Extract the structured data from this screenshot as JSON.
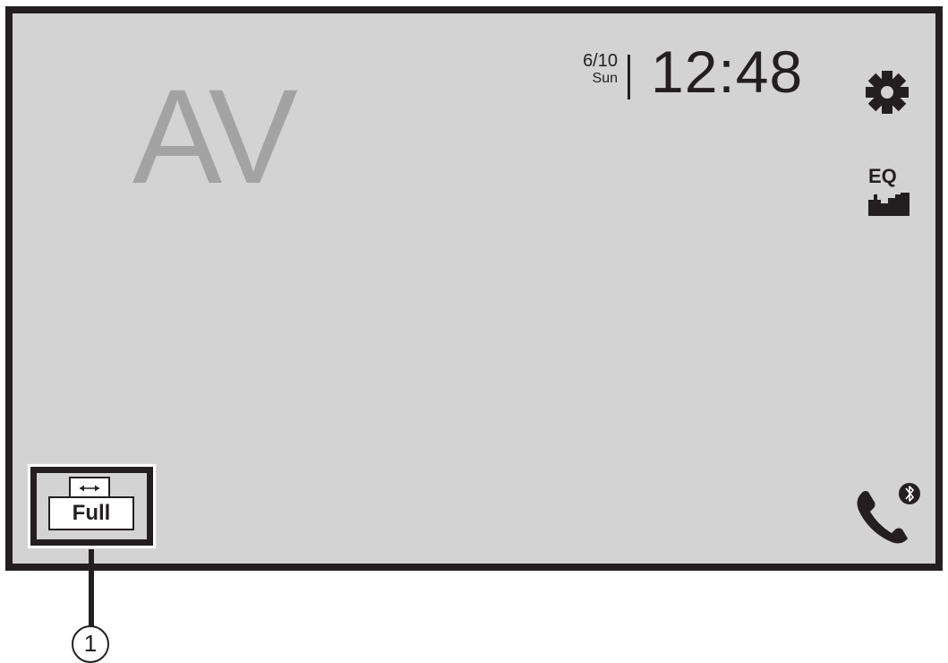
{
  "screen": {
    "source_title": "AV",
    "date": "6/10",
    "day": "Sun",
    "time": "12:48"
  },
  "buttons": {
    "settings_icon": "gear-icon",
    "eq_label": "EQ",
    "eq_icon": "eq-bars-icon",
    "phone_icon": "phone-bluetooth-icon",
    "full_label": "Full",
    "full_icon": "horizontal-arrows-icon"
  },
  "callout": {
    "number": "1"
  },
  "colors": {
    "screen_background": "#d3d3d3",
    "frame": "#231f20",
    "source_title": "#a3a3a3"
  }
}
